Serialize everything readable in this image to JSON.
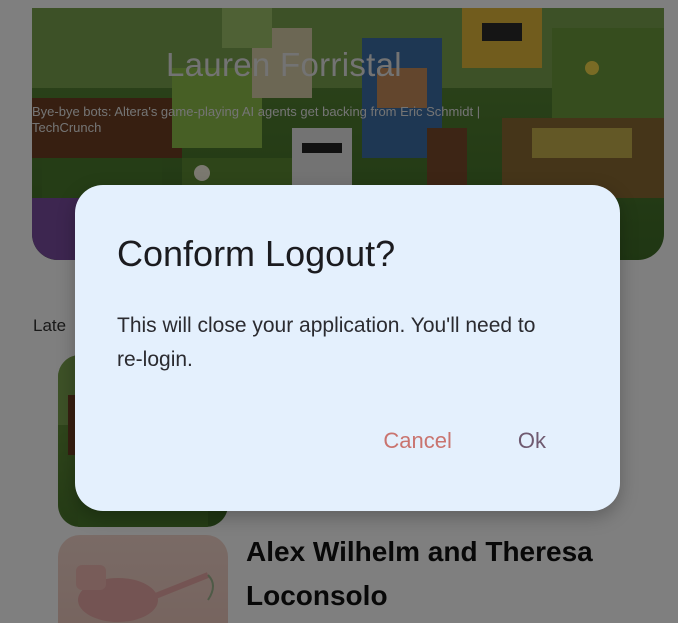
{
  "featured": {
    "author": "Lauren Forristal",
    "title": "Bye-bye bots: Altera's game-playing AI agents get backing from Eric Schmidt | TechCrunch"
  },
  "latest": {
    "section_label": "Late",
    "articles": [
      {
        "title": ""
      },
      {
        "title": "Alex Wilhelm and Theresa Loconsolo"
      }
    ]
  },
  "dialog": {
    "title": "Conform Logout?",
    "message": "This will close your application. You'll need to re-login.",
    "cancel_label": "Cancel",
    "ok_label": "Ok"
  },
  "colors": {
    "dialog_bg": "#e4f0fd",
    "cancel": "#c9746f",
    "ok": "#6f5a70"
  },
  "icons": [
    "minecraft-scene-image",
    "watering-can-image"
  ]
}
